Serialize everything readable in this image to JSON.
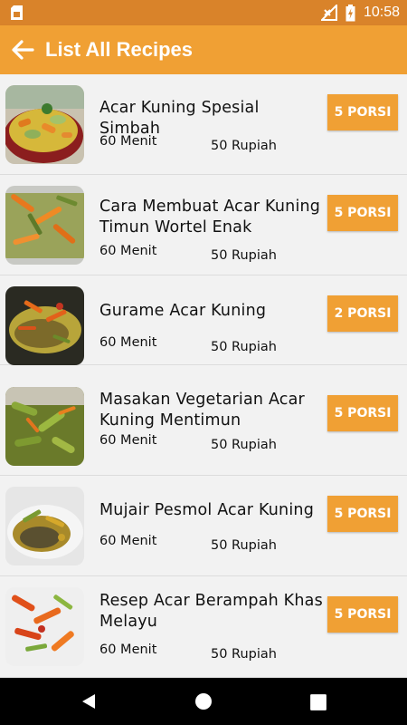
{
  "status_bar": {
    "time": "10:58",
    "icons": [
      "sim-card-icon",
      "no-signal-icon",
      "battery-charging-icon"
    ]
  },
  "app_bar": {
    "title": "List All Recipes",
    "back_icon": "arrow-back-icon",
    "color": "#f0a034"
  },
  "recipes": [
    {
      "name": "Acar Kuning Spesial Simbah",
      "time": "60 Menit",
      "price": "50 Rupiah",
      "porsi": "5 PORSI"
    },
    {
      "name": "Cara Membuat Acar Kuning Timun Wortel Enak",
      "time": "60 Menit",
      "price": "50 Rupiah",
      "porsi": "5 PORSI"
    },
    {
      "name": "Gurame Acar Kuning",
      "time": "60 Menit",
      "price": "50 Rupiah",
      "porsi": "2 PORSI"
    },
    {
      "name": "Masakan Vegetarian Acar Kuning Mentimun",
      "time": "60 Menit",
      "price": "50 Rupiah",
      "porsi": "5 PORSI"
    },
    {
      "name": "Mujair Pesmol Acar Kuning",
      "time": "60 Menit",
      "price": "50 Rupiah",
      "porsi": "5 PORSI"
    },
    {
      "name": "Resep Acar Berampah Khas Melayu",
      "time": "60 Menit",
      "price": "50 Rupiah",
      "porsi": "5 PORSI"
    }
  ],
  "nav_bar": {
    "icons": [
      "back-triangle-icon",
      "home-circle-icon",
      "recents-square-icon"
    ]
  }
}
